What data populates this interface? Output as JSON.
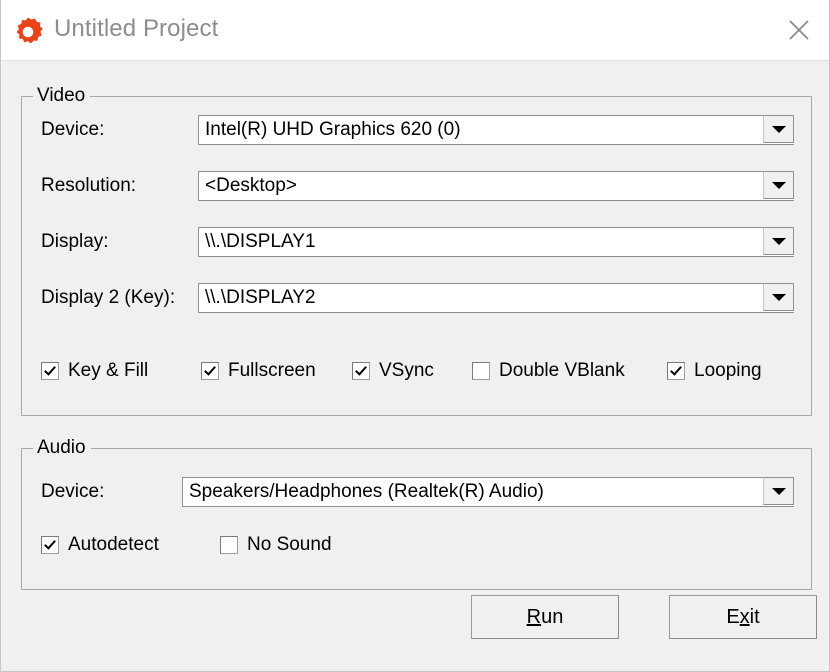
{
  "window": {
    "title": "Untitled Project",
    "icon": "gear-icon",
    "close_icon": "close-icon",
    "accent_color": "#E8431B",
    "title_color": "#8d8d8d",
    "background": "#f0f0f0"
  },
  "video": {
    "group_title": "Video",
    "fields": [
      {
        "label": "Device:",
        "value": "Intel(R) UHD Graphics 620 (0)"
      },
      {
        "label": "Resolution:",
        "value": "<Desktop>"
      },
      {
        "label": "Display:",
        "value": "\\\\.\\DISPLAY1"
      },
      {
        "label": "Display 2 (Key):",
        "value": "\\\\.\\DISPLAY2"
      }
    ],
    "checkboxes": [
      {
        "label": "Key & Fill",
        "checked": true
      },
      {
        "label": "Fullscreen",
        "checked": true
      },
      {
        "label": "VSync",
        "checked": true
      },
      {
        "label": "Double VBlank",
        "checked": false
      },
      {
        "label": "Looping",
        "checked": true
      }
    ]
  },
  "audio": {
    "group_title": "Audio",
    "fields": [
      {
        "label": "Device:",
        "value": "Speakers/Headphones (Realtek(R) Audio)"
      }
    ],
    "checkboxes": [
      {
        "label": "Autodetect",
        "checked": true
      },
      {
        "label": "No Sound",
        "checked": false
      }
    ]
  },
  "buttons": {
    "run": {
      "prefix": "R",
      "suffix": "un",
      "accel": "R",
      "full": "Run"
    },
    "exit": {
      "prefix": "E",
      "accel": "x",
      "suffix": "it",
      "full": "Exit"
    }
  }
}
